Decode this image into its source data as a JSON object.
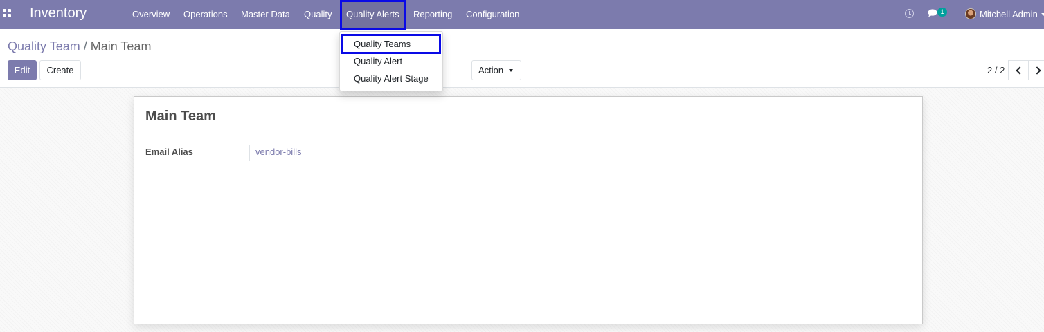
{
  "navbar": {
    "app_title": "Inventory",
    "apps_icon": "apps-grid-icon",
    "menu": [
      "Overview",
      "Operations",
      "Master Data",
      "Quality",
      "Quality Alerts",
      "Reporting",
      "Configuration"
    ],
    "active_menu": "Quality Alerts",
    "systray": {
      "clock_icon": "clock-icon",
      "chat_icon": "chat-icon",
      "message_count": "1",
      "user_name": "Mitchell Admin"
    },
    "color": "#7c7bad",
    "highlight_color": "#0a0ae6"
  },
  "dropdown": {
    "items": [
      "Quality Teams",
      "Quality Alert",
      "Quality Alert Stage"
    ],
    "highlighted": "Quality Teams"
  },
  "breadcrumb": {
    "parent": "Quality Team",
    "separator": "/",
    "current": "Main Team"
  },
  "buttons": {
    "edit": "Edit",
    "create": "Create",
    "action": "Action"
  },
  "pager": {
    "value": "2 / 2"
  },
  "form": {
    "title": "Main Team",
    "fields": [
      {
        "label": "Email Alias",
        "value": "vendor-bills"
      }
    ]
  }
}
